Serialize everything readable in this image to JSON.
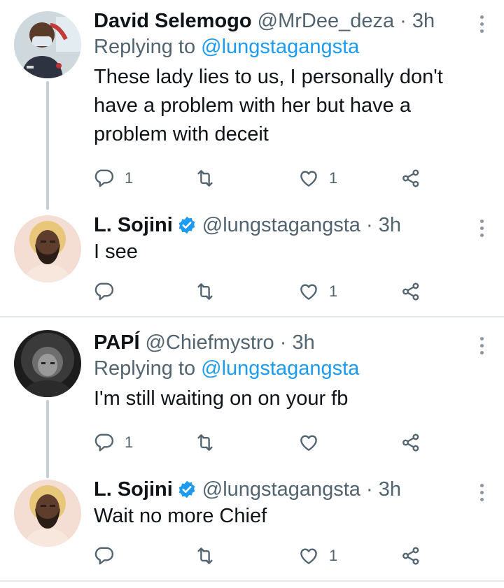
{
  "tweets": [
    {
      "name": "David Selemogo",
      "handle": "@MrDee_deza · 3h",
      "replying_prefix": "Replying to ",
      "replying_to": "@lungstagangsta",
      "lines": [
        "These lady lies to us, I personally don't",
        "have a problem with her but have a",
        "problem with deceit"
      ],
      "reply_count": "1",
      "retweet_count": "",
      "like_count": "1"
    },
    {
      "name": "L. Sojini",
      "handle": "@lungstagangsta · 3h",
      "lines": [
        "I see"
      ],
      "reply_count": "",
      "retweet_count": "",
      "like_count": "1"
    },
    {
      "name": "PAPÍ",
      "handle": "@Chiefmystro · 3h",
      "replying_prefix": "Replying to ",
      "replying_to": "@lungstagangsta",
      "lines": [
        "I'm still waiting on on your fb"
      ],
      "reply_count": "1",
      "retweet_count": "",
      "like_count": ""
    },
    {
      "name": "L. Sojini",
      "handle": "@lungstagangsta · 3h",
      "lines": [
        "Wait no more Chief"
      ],
      "reply_count": "",
      "retweet_count": "",
      "like_count": "1"
    }
  ],
  "colors": {
    "accent": "#1d9bf0",
    "muted": "#536471",
    "icon": "#536471",
    "verified": "#1d9bf0"
  },
  "icons": [
    "reply-icon",
    "retweet-icon",
    "like-icon",
    "share-icon",
    "more-icon",
    "verified-badge-icon"
  ]
}
